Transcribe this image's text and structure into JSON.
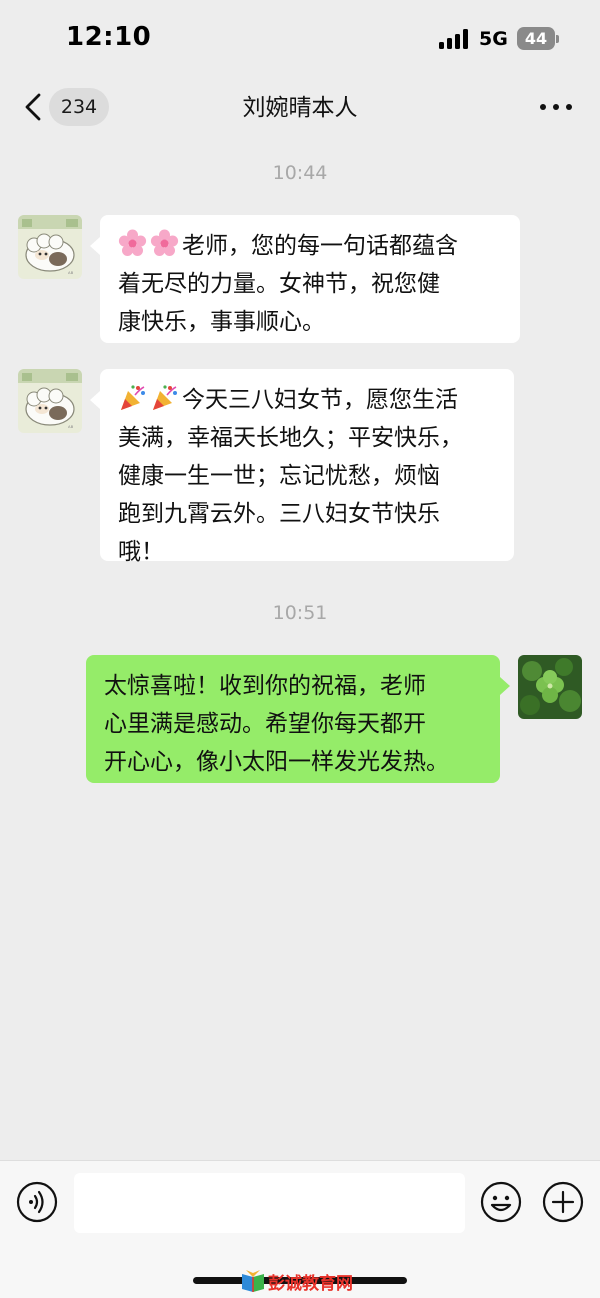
{
  "status_bar": {
    "time": "12:10",
    "network": "5G",
    "battery": "44",
    "signal_icon": "signal-bars-icon"
  },
  "nav": {
    "back_icon": "chevron-left-icon",
    "unread_count": "234",
    "title": "刘婉晴本人",
    "more_icon": "more-dots-icon"
  },
  "messages": [
    {
      "timestamp": "10:44",
      "direction": "incoming",
      "avatar": "sheep-avatar",
      "emoji": [
        "🌸",
        "🌸"
      ],
      "lines": [
        "老师，您的每一句话都蕴含",
        "着无尽的力量。女神节，祝您健",
        "康快乐，事事顺心。"
      ]
    },
    {
      "direction": "incoming",
      "avatar": "sheep-avatar",
      "emoji": [
        "🎉",
        "🎉"
      ],
      "lines": [
        "今天三八妇女节，愿您生活",
        "美满，幸福天长地久；平安快乐，",
        "健康一生一世；忘记忧愁，烦恼",
        "跑到九霄云外。三八妇女节快乐",
        "哦！"
      ]
    },
    {
      "timestamp": "10:51",
      "direction": "outgoing",
      "avatar": "clover-avatar",
      "lines": [
        "太惊喜啦！收到你的祝福，老师",
        "心里满是感动。希望你每天都开",
        "开心心，像小太阳一样发光发热。"
      ]
    }
  ],
  "input_bar": {
    "voice_icon": "voice-icon",
    "input_placeholder": "",
    "emoji_icon": "smiley-icon",
    "plus_icon": "plus-icon"
  },
  "watermark": {
    "text": "彭诚教育网",
    "icon": "book-logo-icon"
  },
  "colors": {
    "background": "#ededed",
    "incoming_bubble": "#ffffff",
    "outgoing_bubble": "#95ec69",
    "timestamp": "#a8a8a8",
    "watermark": "#e8322a"
  }
}
